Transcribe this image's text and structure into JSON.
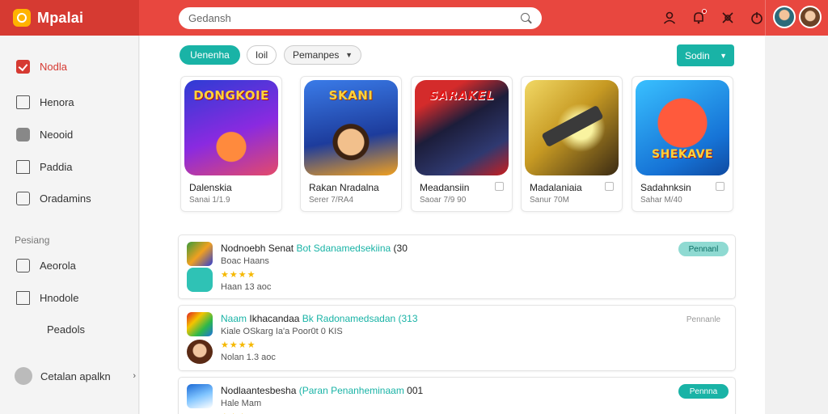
{
  "app": {
    "name": "Mpalai"
  },
  "search": {
    "placeholder": "Gedansh"
  },
  "sidebar": {
    "items": [
      {
        "label": "Nodla"
      },
      {
        "label": "Henora"
      },
      {
        "label": "Neooid"
      },
      {
        "label": "Paddia"
      },
      {
        "label": "Oradamins"
      }
    ],
    "section_label": "Pesiang",
    "section_items": [
      {
        "label": "Aeorola"
      },
      {
        "label": "Hnodole"
      },
      {
        "label": "Peadols"
      }
    ],
    "footer": {
      "label": "Cetalan apalkn"
    }
  },
  "filters": {
    "chip_active": "Uenenha",
    "chip_plain": "Ioil",
    "dropdown": "Pemanpes",
    "sort_button": "Sodin"
  },
  "cards": [
    {
      "art_text": "DONGKOIE",
      "title": "Dalenskia",
      "sub": "Sanai 1/1.9"
    },
    {
      "art_text": "SKANI",
      "title": "Rakan Nradalna",
      "sub": "Serer 7/RA4"
    },
    {
      "art_text": "SARAKEL",
      "title": "Meadansiin",
      "sub": "Saoar 7/9 90"
    },
    {
      "art_text": "",
      "title": "Madalaniaia",
      "sub": "Sanur 70M"
    },
    {
      "art_text": "SHEKAVE",
      "title": "Sadahnksin",
      "sub": "Sahar M/40"
    }
  ],
  "rows": [
    {
      "title": "Nodnoebh",
      "title2": "Senat",
      "accent": "Bot Sdanamedsekiina",
      "suffix": "(30",
      "sub": "Boac Haans",
      "stars": "★★★★",
      "meta": "Haan 13 aoc",
      "pill": "Pennanl"
    },
    {
      "title": "Naam",
      "title2": "Ikhacandaa",
      "accent": "Bk Radonamedsadan (313",
      "suffix": "",
      "sub": "Kiale OSkarg Ia'a Poor0t 0 KIS",
      "stars": "★★★★",
      "meta": "Nolan 1.3 aoc",
      "pill": "Pennanle"
    },
    {
      "title": "Nodlaantesbesha",
      "title2": "",
      "accent": "(Paran Penanheminaam",
      "suffix": "001",
      "sub": "Hale Mam",
      "stars": "★★★",
      "meta": "",
      "pill": "Pennna"
    }
  ],
  "colors": {
    "topbar": "#e8473f",
    "accent": "#19b3a6",
    "star": "#f5b800"
  }
}
